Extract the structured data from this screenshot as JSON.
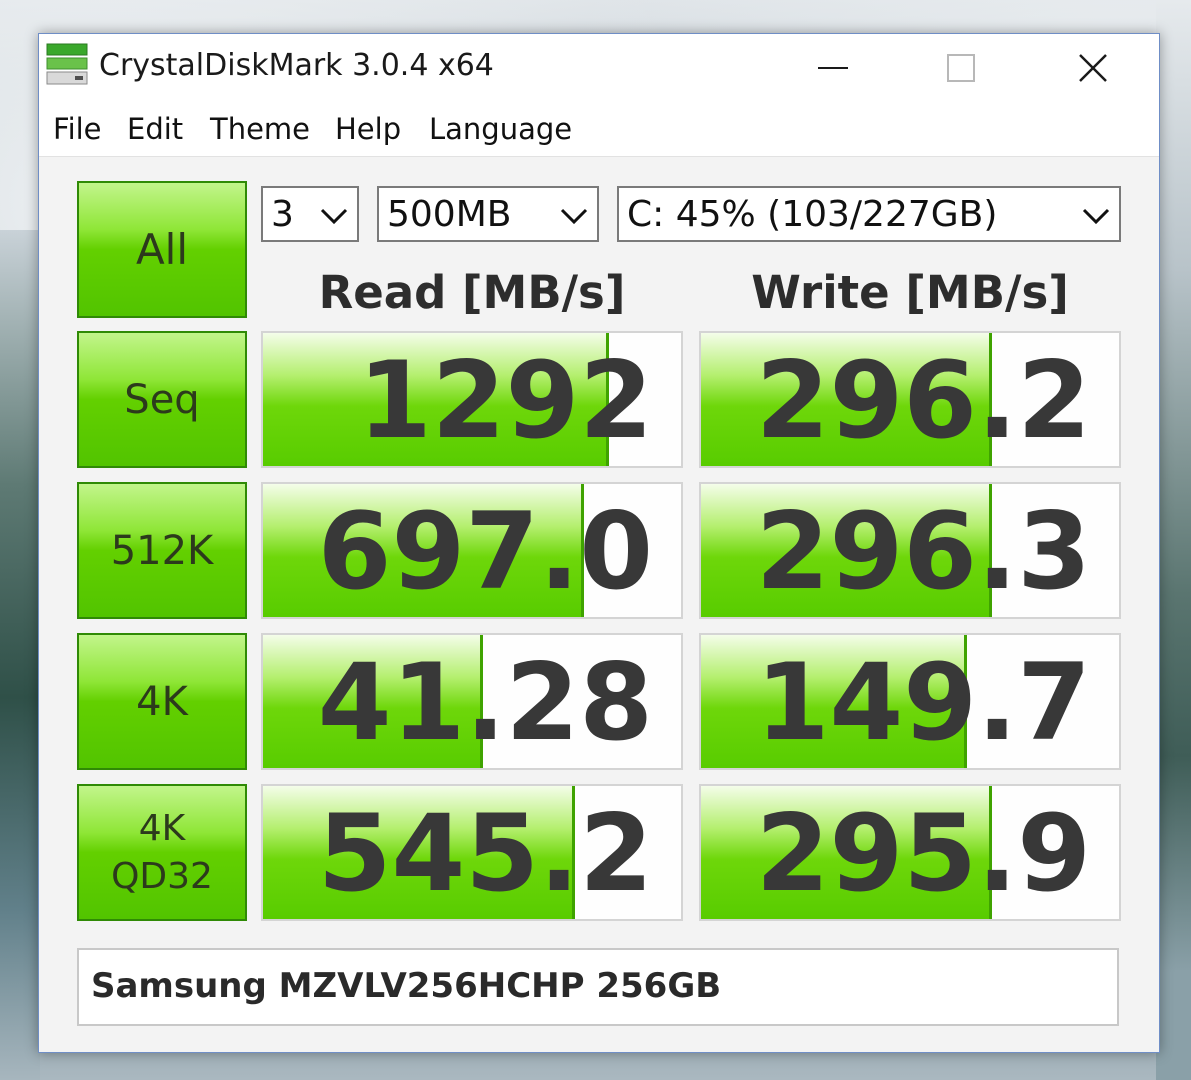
{
  "window": {
    "title": "CrystalDiskMark 3.0.4 x64"
  },
  "menu": [
    "File",
    "Edit",
    "Theme",
    "Help",
    "Language"
  ],
  "controls": {
    "all_label": "All",
    "test_count": "3",
    "test_size": "500MB",
    "drive": "C: 45% (103/227GB)"
  },
  "headers": {
    "read": "Read [MB/s]",
    "write": "Write [MB/s]"
  },
  "rows": [
    {
      "label": "Seq",
      "read": "1292",
      "write": "296.2",
      "read_fill": 0.82,
      "write_fill": 0.69
    },
    {
      "label": "512K",
      "read": "697.0",
      "write": "296.3",
      "read_fill": 0.76,
      "write_fill": 0.69
    },
    {
      "label": "4K",
      "read": "41.28",
      "write": "149.7",
      "read_fill": 0.52,
      "write_fill": 0.63
    },
    {
      "label": "4K QD32",
      "label_line1": "4K",
      "label_line2": "QD32",
      "read": "545.2",
      "write": "295.9",
      "read_fill": 0.74,
      "write_fill": 0.69
    }
  ],
  "drive_model": "Samsung MZVLV256HCHP 256GB",
  "colors": {
    "accent_green": "#63d000",
    "button_border": "#2f8a05",
    "value_text": "#383838"
  },
  "icons": {
    "app": "crystaldiskmark-disk-icon",
    "minimize": "minimize-icon",
    "maximize": "maximize-icon",
    "close": "close-icon",
    "dropdown": "chevron-down-icon"
  }
}
